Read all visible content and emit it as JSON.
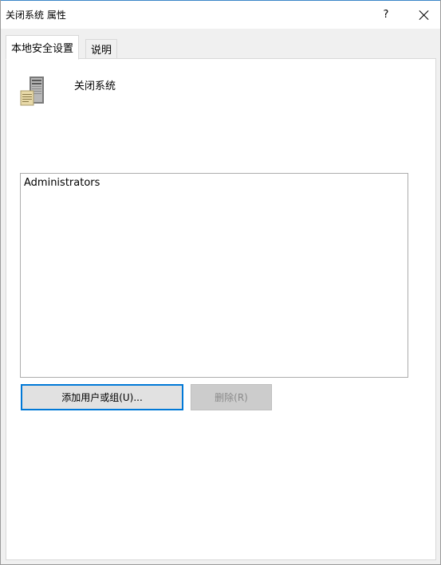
{
  "window": {
    "title": "关闭系统 属性",
    "help_label": "?"
  },
  "tabs": [
    {
      "label": "本地安全设置",
      "active": true
    },
    {
      "label": "说明",
      "active": false
    }
  ],
  "policy": {
    "icon": "server-icon",
    "name": "关闭系统"
  },
  "assigned_list": {
    "items": [
      "Administrators"
    ]
  },
  "buttons": {
    "add_label": "添加用户或组(U)...",
    "remove_label": "删除(R)",
    "remove_enabled": false
  },
  "colors": {
    "accent": "#0078d7",
    "title_border": "#3c86c8",
    "window_bg": "#f0f0f0",
    "panel_bg": "#ffffff",
    "disabled_text": "#8a8a8a"
  }
}
